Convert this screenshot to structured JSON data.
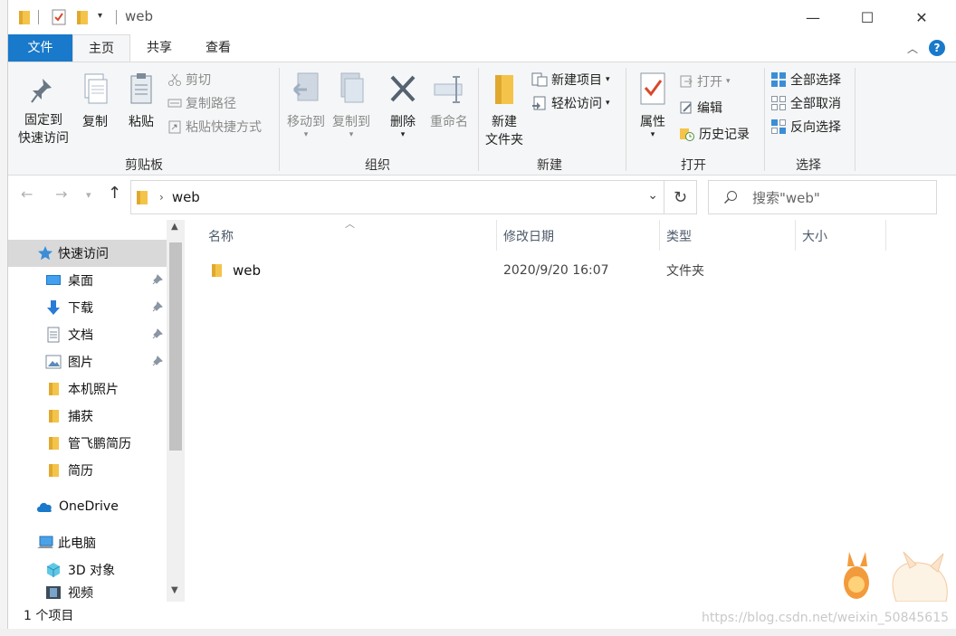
{
  "window": {
    "title": "web",
    "minimize": "—",
    "maximize": "☐",
    "close": "✕"
  },
  "tabs": [
    {
      "label": "文件"
    },
    {
      "label": "主页"
    },
    {
      "label": "共享"
    },
    {
      "label": "查看"
    }
  ],
  "ribbon": {
    "clipboard": {
      "label": "剪贴板",
      "pin_line1": "固定到",
      "pin_line2": "快速访问",
      "copy": "复制",
      "paste": "粘贴",
      "cut": "剪切",
      "copy_path": "复制路径",
      "paste_shortcut": "粘贴快捷方式"
    },
    "organize": {
      "label": "组织",
      "move_to": "移动到",
      "copy_to": "复制到",
      "delete": "删除",
      "rename": "重命名"
    },
    "new": {
      "label": "新建",
      "new_folder_line1": "新建",
      "new_folder_line2": "文件夹",
      "new_item": "新建项目",
      "easy_access": "轻松访问"
    },
    "open": {
      "label": "打开",
      "properties": "属性",
      "open": "打开",
      "edit": "编辑",
      "history": "历史记录"
    },
    "select": {
      "label": "选择",
      "select_all": "全部选择",
      "select_none": "全部取消",
      "invert": "反向选择"
    }
  },
  "address": {
    "path": "web",
    "search_placeholder": "搜索\"web\""
  },
  "nav": {
    "quick_access": "快速访问",
    "items": [
      {
        "label": "桌面",
        "pinned": true
      },
      {
        "label": "下载",
        "pinned": true
      },
      {
        "label": "文档",
        "pinned": true
      },
      {
        "label": "图片",
        "pinned": true
      },
      {
        "label": "本机照片",
        "pinned": false
      },
      {
        "label": "捕获",
        "pinned": false
      },
      {
        "label": "管飞鹏简历",
        "pinned": false
      },
      {
        "label": "简历",
        "pinned": false
      }
    ],
    "onedrive": "OneDrive",
    "this_pc": "此电脑",
    "objects3d": "3D 对象",
    "videos": "视频"
  },
  "columns": {
    "name": "名称",
    "modified": "修改日期",
    "type": "类型",
    "size": "大小"
  },
  "files": [
    {
      "name": "web",
      "modified": "2020/9/20 16:07",
      "type": "文件夹",
      "size": ""
    }
  ],
  "status": {
    "count": "1 个项目"
  },
  "watermark": "https://blog.csdn.net/weixin_50845615",
  "colors": {
    "accent": "#1979ca",
    "folder": "#f4c44a",
    "ribbon_bg": "#f5f6f7"
  }
}
